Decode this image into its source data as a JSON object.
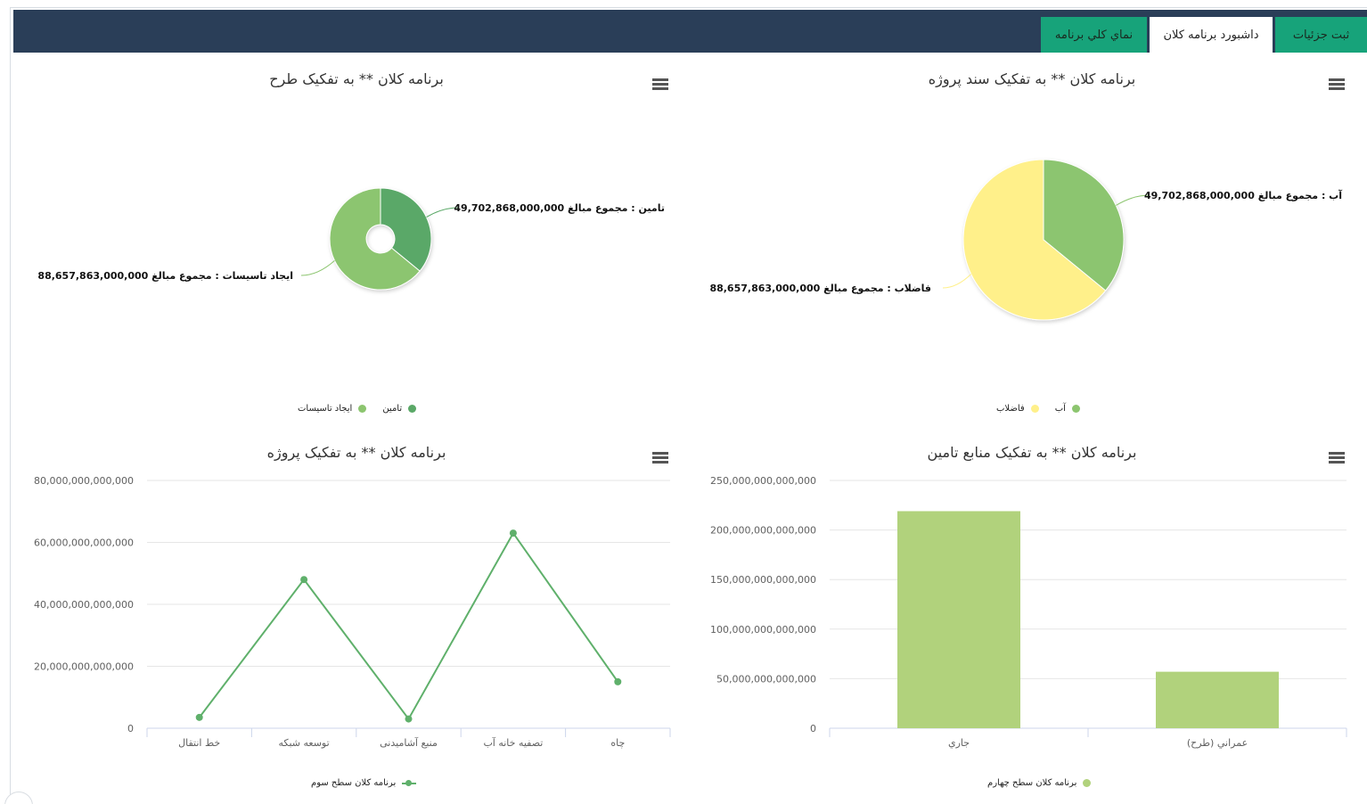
{
  "tabs": [
    {
      "label": "ثبت جزئیات"
    },
    {
      "label": "داشبورد برنامه کلان"
    },
    {
      "label": "نماي كلي برنامه"
    }
  ],
  "colors": {
    "topbar": "#2a3e58",
    "tab_green": "#17a37a",
    "pie_green": "#8cc56f",
    "pie_yellow": "#fff08a",
    "donut_dark": "#5aa867",
    "bar_green": "#b1d27c",
    "line_green": "#5fb06b"
  },
  "panels": {
    "project_doc": {
      "title": "برنامه کلان ** به تفکیک سند پروژه",
      "legend": [
        "آب",
        "فاضلاب"
      ]
    },
    "plan": {
      "title": "برنامه کلان ** به تفکیک طرح",
      "legend": [
        "تامین",
        "ایجاد تاسیسات"
      ]
    },
    "funding": {
      "title": "برنامه کلان ** به تفکیک منابع تامین",
      "legend": [
        "برنامه کلان سطح چهارم"
      ]
    },
    "project": {
      "title": "برنامه کلان ** به تفکیک پروژه",
      "legend": [
        "برنامه کلان سطح سوم"
      ]
    }
  },
  "chart_data": [
    {
      "id": "project_doc",
      "type": "pie",
      "title": "برنامه کلان ** به تفکیک سند پروژه",
      "categories": [
        "آب",
        "فاضلاب"
      ],
      "values": [
        49702868000000,
        88657863000000
      ],
      "data_labels": [
        "آب : مجموع مبالغ 49,702,868,000,000",
        "فاضلاب : مجموع مبالغ 88,657,863,000,000"
      ],
      "colors": [
        "#8cc56f",
        "#fff08a"
      ],
      "legend": "bottom-center"
    },
    {
      "id": "plan",
      "type": "pie",
      "title": "برنامه کلان ** به تفکیک طرح",
      "categories": [
        "تامین",
        "ایجاد تاسیسات"
      ],
      "values": [
        49702868000000,
        88657863000000
      ],
      "data_labels": [
        "تامین : مجموع مبالغ 49,702,868,000,000",
        "ایجاد تاسیسات : مجموع مبالغ 88,657,863,000,000"
      ],
      "colors": [
        "#5aa867",
        "#8cc56f"
      ],
      "legend": "bottom-center"
    },
    {
      "id": "funding",
      "type": "bar",
      "title": "برنامه کلان ** به تفکیک منابع تامین",
      "categories": [
        "جاري",
        "عمراني (طرح)"
      ],
      "series": [
        {
          "name": "برنامه کلان سطح چهارم",
          "values": [
            219000000000000,
            57000000000000
          ]
        }
      ],
      "ylim": [
        0,
        250000000000000
      ],
      "yticks": [
        0,
        50000000000000,
        100000000000000,
        150000000000000,
        200000000000000,
        250000000000000
      ],
      "ytick_labels": [
        "0",
        "50,000,000,000,000",
        "100,000,000,000,000",
        "150,000,000,000,000",
        "200,000,000,000,000",
        "250,000,000,000,000"
      ],
      "grid": true,
      "legend": "bottom-center"
    },
    {
      "id": "project",
      "type": "line",
      "title": "برنامه کلان ** به تفکیک پروژه",
      "categories": [
        "خط انتقال",
        "توسعه شبکه",
        "منبع آشامیدنی",
        "تصفیه خانه آب",
        "چاه"
      ],
      "series": [
        {
          "name": "برنامه کلان سطح سوم",
          "values": [
            3500000000000,
            48000000000000,
            3000000000000,
            63000000000000,
            15000000000000
          ]
        }
      ],
      "ylim": [
        0,
        80000000000000
      ],
      "yticks": [
        0,
        20000000000000,
        40000000000000,
        60000000000000,
        80000000000000
      ],
      "ytick_labels": [
        "0",
        "20,000,000,000,000",
        "40,000,000,000,000",
        "60,000,000,000,000",
        "80,000,000,000,000"
      ],
      "grid": true,
      "legend": "bottom-center"
    }
  ]
}
